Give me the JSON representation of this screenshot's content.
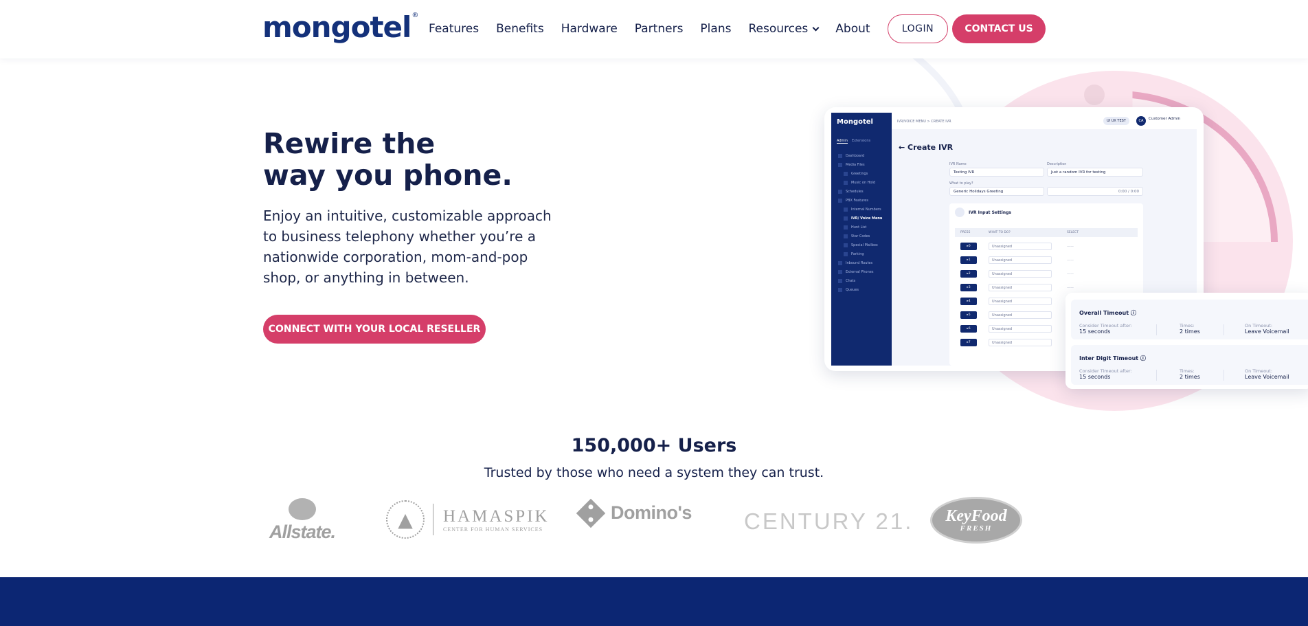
{
  "header": {
    "logo_text": "mongotel",
    "logo_mark": "®",
    "nav": [
      {
        "label": "Features"
      },
      {
        "label": "Benefits"
      },
      {
        "label": "Hardware"
      },
      {
        "label": "Partners"
      },
      {
        "label": "Plans"
      },
      {
        "label": "Resources",
        "has_dropdown": true
      },
      {
        "label": "About"
      }
    ],
    "login_label": "LOGIN",
    "contact_label": "CONTACT US"
  },
  "hero": {
    "headline_line1": "Rewire the",
    "headline_line2": "way you phone.",
    "subtext": "Enjoy an intuitive, customizable approach to business telephony whether you’re a nationwide corporation, mom-and-pop shop, or anything in between.",
    "cta_label": "CONNECT WITH YOUR LOCAL RESELLER"
  },
  "mock_app": {
    "logo": "Mongotel",
    "tabs": [
      "Admin",
      "Extensions"
    ],
    "sidebar": [
      {
        "label": "Dashboard",
        "level": 0
      },
      {
        "label": "Media Files",
        "level": 0
      },
      {
        "label": "Greetings",
        "level": 1
      },
      {
        "label": "Music on Hold",
        "level": 1
      },
      {
        "label": "Schedules",
        "level": 0
      },
      {
        "label": "PBX Features",
        "level": 0
      },
      {
        "label": "Internal Numbers",
        "level": 1
      },
      {
        "label": "IVR/ Voice Menu",
        "level": 1,
        "active": true
      },
      {
        "label": "Hunt List",
        "level": 1
      },
      {
        "label": "Star Codes",
        "level": 1
      },
      {
        "label": "Special Mailbox",
        "level": 1
      },
      {
        "label": "Parking",
        "level": 1
      },
      {
        "label": "Inbound Routes",
        "level": 0
      },
      {
        "label": "External Phones",
        "level": 0
      },
      {
        "label": "Chats",
        "level": 0
      },
      {
        "label": "Queues",
        "level": 0
      }
    ],
    "breadcrumb": "IVR/VOICE MENU   >   CREATE IVR",
    "tag": "UI UX TEST",
    "avatar": "CA",
    "user_name": "Customer Admin",
    "page_title": "← Create IVR",
    "ivr_name_label": "IVR Name",
    "ivr_name_value": "Testing IVR",
    "description_label": "Description",
    "description_value": "Just a random IVR for testing",
    "what_to_play_label": "What to play?",
    "what_to_play_value": "Generic Holidays Greeting",
    "audio_time": "0:00 / 0:00",
    "settings_title": "IVR Input Settings",
    "columns": [
      "PRESS",
      "WHAT TO DO?",
      "SELECT"
    ],
    "rows": [
      {
        "key": "0",
        "action": "Unassigned",
        "select": "——"
      },
      {
        "key": "1",
        "action": "Unassigned",
        "select": "——"
      },
      {
        "key": "2",
        "action": "Unassigned",
        "select": "——"
      },
      {
        "key": "3",
        "action": "Unassigned",
        "select": "——"
      },
      {
        "key": "4",
        "action": "Unassigned",
        "select": "——"
      },
      {
        "key": "5",
        "action": "Unassigned",
        "select": "——"
      },
      {
        "key": "6",
        "action": "Unassigned",
        "select": "——"
      },
      {
        "key": "7",
        "action": "Unassigned",
        "select": "——"
      }
    ]
  },
  "timeout_card": {
    "overall": {
      "title": "Overall Timeout",
      "consider_label": "Consider Timeout after:",
      "consider_value": "15 seconds",
      "times_label": "Times:",
      "times_value": "2 times",
      "on_timeout_label": "On Timeout:",
      "on_timeout_value": "Leave Voicemail"
    },
    "inter_digit": {
      "title": "Inter Digit Timeout",
      "consider_label": "Consider Timeout after:",
      "consider_value": "15 seconds",
      "times_label": "Times:",
      "times_value": "2 times",
      "on_timeout_label": "On Timeout:",
      "on_timeout_value": "Leave Voicemail"
    }
  },
  "users": {
    "count": "150,000+ Users",
    "tagline": "Trusted by those who need a system they can trust."
  },
  "logos": {
    "allstate": "Allstate.",
    "hamaspik_name": "HAMASPIK",
    "hamaspik_sub": "CENTER FOR HUMAN SERVICES",
    "dominos": "Domino's",
    "century21": "CENTURY 21.",
    "keyfood": "KeyFood",
    "keyfood_sub": "FRESH"
  },
  "colors": {
    "brand_navy": "#14317a",
    "accent_pink": "#d53e69",
    "footer_band": "#0c2673"
  }
}
